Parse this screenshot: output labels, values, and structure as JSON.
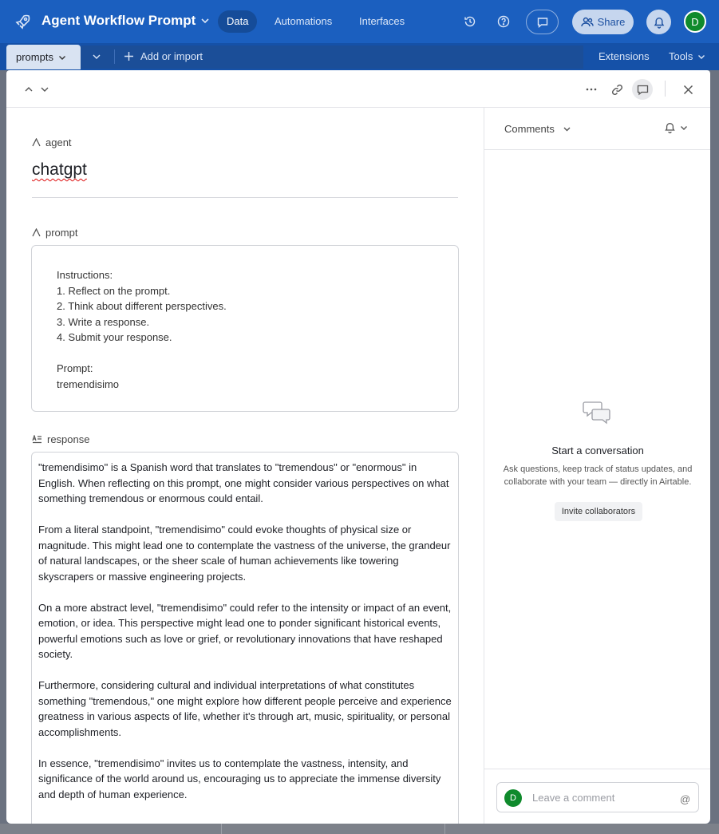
{
  "header": {
    "app_title": "Agent Workflow Prompt",
    "tabs": [
      {
        "label": "Data",
        "active": true
      },
      {
        "label": "Automations",
        "active": false
      },
      {
        "label": "Interfaces",
        "active": false
      }
    ],
    "share_label": "Share",
    "avatar_initial": "D",
    "accent_color": "#1b5fbf"
  },
  "subbar": {
    "table_tab": "prompts",
    "add_import": "Add or import",
    "extensions": "Extensions",
    "tools": "Tools"
  },
  "record": {
    "fields": {
      "agent": {
        "label": "agent",
        "value": "chatgpt"
      },
      "prompt": {
        "label": "prompt",
        "lines": [
          "Instructions:",
          "1. Reflect on the prompt.",
          "2. Think about different perspectives.",
          "3. Write a response.",
          "4. Submit your response.",
          "",
          "Prompt:",
          "tremendisimo"
        ]
      },
      "response": {
        "label": "response",
        "paragraphs": [
          "\"tremendisimo\" is a Spanish word that translates to \"tremendous\" or \"enormous\" in English. When reflecting on this prompt, one might consider various perspectives on what something tremendous or enormous could entail.",
          "From a literal standpoint, \"tremendisimo\" could evoke thoughts of physical size or magnitude. This might lead one to contemplate the vastness of the universe, the grandeur of natural landscapes, or the sheer scale of human achievements like towering skyscrapers or massive engineering projects.",
          "On a more abstract level, \"tremendisimo\" could refer to the intensity or impact of an event, emotion, or idea. This perspective might lead one to ponder significant historical events, powerful emotions such as love or grief, or revolutionary innovations that have reshaped society.",
          "Furthermore, considering cultural and individual interpretations of what constitutes something \"tremendous,\" one might explore how different people perceive and experience greatness in various aspects of life, whether it's through art, music, spirituality, or personal accomplishments.",
          "In essence, \"tremendisimo\" invites us to contemplate the vastness, intensity, and significance of the world around us, encouraging us to appreciate the immense diversity and depth of human experience."
        ]
      }
    }
  },
  "comments": {
    "title": "Comments",
    "empty_title": "Start a conversation",
    "empty_desc": "Ask questions, keep track of status updates, and collaborate with your team — directly in Airtable.",
    "invite_label": "Invite collaborators",
    "input_placeholder": "Leave a comment",
    "avatar_initial": "D",
    "mention_symbol": "@"
  }
}
